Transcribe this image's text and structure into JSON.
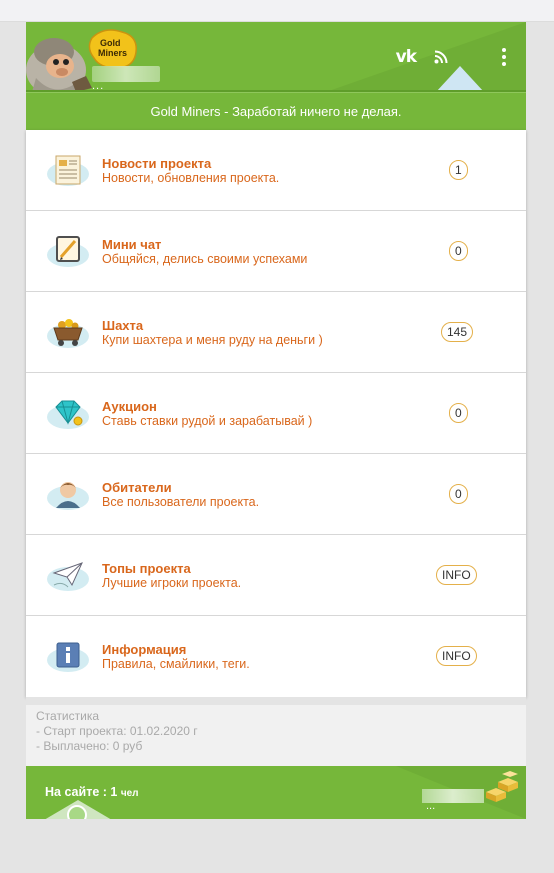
{
  "header": {
    "logo_text_1": "Gold",
    "logo_text_2": "Miners",
    "user_masked": "...",
    "social_icons": [
      "vk-icon",
      "rss-icon"
    ],
    "menu_icon": "kebab-menu-icon",
    "subtitle": "Gold Miners - Заработай ничего не делая."
  },
  "items": [
    {
      "title": "Новости проекта",
      "desc": "Новости, обновления проекта.",
      "badge": "1",
      "icon": "newspaper-icon"
    },
    {
      "title": "Мини чат",
      "desc": "Общяйся, делись своими успехами",
      "badge": "0",
      "icon": "chat-pencil-icon"
    },
    {
      "title": "Шахта",
      "desc": "Купи шахтера и меня руду на деньги )",
      "badge": "145",
      "icon": "mine-cart-icon"
    },
    {
      "title": "Аукцион",
      "desc": "Ставь ставки рудой и зарабатывай )",
      "badge": "0",
      "icon": "diamond-icon"
    },
    {
      "title": "Обитатели",
      "desc": "Все пользователи проекта.",
      "badge": "0",
      "icon": "user-avatar-icon"
    },
    {
      "title": "Топы проекта",
      "desc": "Лучшие игроки проекта.",
      "badge": "INFO",
      "icon": "paper-plane-icon"
    },
    {
      "title": "Информация",
      "desc": "Правила, смайлики, теги.",
      "badge": "INFO",
      "icon": "info-icon"
    }
  ],
  "stats": {
    "title": "Статистика",
    "start": "- Старт проекта: 01.02.2020 г",
    "paid": "- Выплачено: 0 руб"
  },
  "footer": {
    "online_label": "На сайте : ",
    "online_count": "1",
    "online_unit": "чел",
    "user_masked": "..."
  },
  "colors": {
    "accent_green": "#76b73a",
    "link_orange": "#d9671c",
    "badge_border": "#e4b04a"
  }
}
